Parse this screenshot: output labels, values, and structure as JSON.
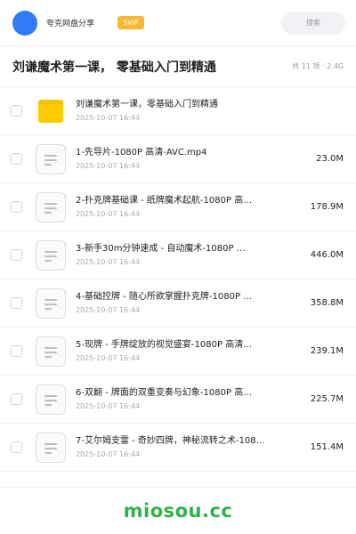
{
  "header": {
    "share_name": "夸克网盘分享",
    "badge": "SVIP",
    "search_placeholder": "搜索"
  },
  "titlebar": {
    "title": "刘谦魔术第一课， 零基础入门到精通",
    "meta": "共 11 项 · 2.4G"
  },
  "files": [
    {
      "name": "刘谦魔术第一课，零基础入门到精通",
      "date": "2025-10-07 16:44",
      "size": "",
      "icon": "folder-icon"
    },
    {
      "name": "1-先导片-1080P 高清-AVC.mp4",
      "date": "2025-10-07 16:44",
      "size": "23.0M",
      "icon": "file-icon"
    },
    {
      "name": "2-扑克牌基础课 - 纸牌魔术起航-1080P 高…",
      "date": "2025-10-07 16:44",
      "size": "178.9M",
      "icon": "file-icon"
    },
    {
      "name": "3-新手30m分钟速成 - 自动魔术-1080P …",
      "date": "2025-10-07 16:44",
      "size": "446.0M",
      "icon": "file-icon"
    },
    {
      "name": "4-基础控牌 - 随心所欲掌握扑克牌-1080P …",
      "date": "2025-10-07 16:44",
      "size": "358.8M",
      "icon": "file-icon"
    },
    {
      "name": "5-现牌 - 手牌绽放的视觉盛宴-1080P 高清…",
      "date": "2025-10-07 16:44",
      "size": "239.1M",
      "icon": "file-icon"
    },
    {
      "name": "6-双翻 - 牌面的双重变奏与幻象-1080P 高…",
      "date": "2025-10-07 16:44",
      "size": "225.7M",
      "icon": "file-icon"
    },
    {
      "name": "7-艾尔姆支雷 - 奇妙四牌，神秘流转之术-108…",
      "date": "2025-10-07 16:44",
      "size": "151.4M",
      "icon": "file-icon"
    }
  ],
  "footer": {
    "brand": "miosou.cc"
  },
  "colors": {
    "accent": "#2f7cf6",
    "badge": "#f7b733",
    "brand": "#2fb24a",
    "folder": "#ffcc00"
  }
}
